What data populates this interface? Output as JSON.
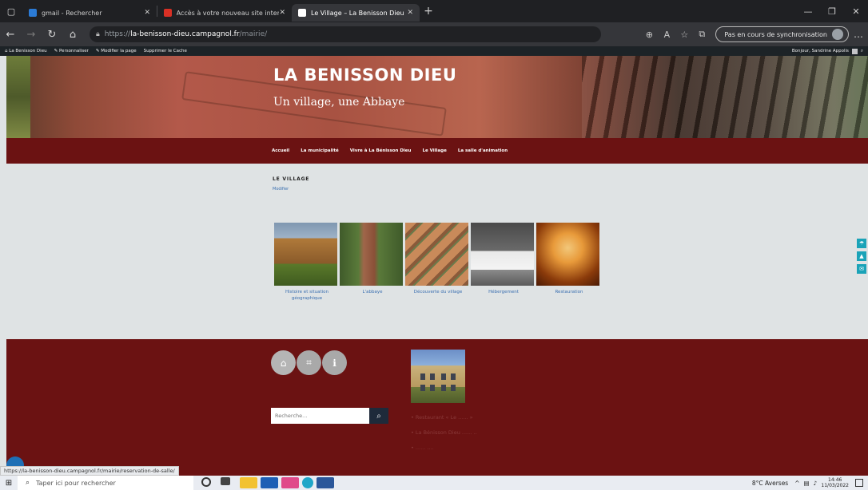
{
  "browser": {
    "tabs": [
      {
        "label": "gmail - Rechercher",
        "favicon_color": "#2b7bd6"
      },
      {
        "label": "Accès à votre nouveau site intern",
        "favicon_color": "#d93025"
      },
      {
        "label": "Le Village – La Benisson Dieu",
        "favicon_color": "#ffffff",
        "active": true
      }
    ],
    "url_scheme": "https://",
    "url_host": "la-benisson-dieu.campagnol.fr",
    "url_path": "/mairie/",
    "sync_label": "Pas en cours de synchronisation"
  },
  "wp_admin_bar": {
    "site_name": "La Benisson Dieu",
    "customize": "Personnaliser",
    "edit_page": "Modifier la page",
    "clear_cache": "Supprimer le Cache",
    "greeting": "Bonjour, Sandrine Appolis"
  },
  "header": {
    "title": "LA BENISSON DIEU",
    "tagline": "Un village, une Abbaye"
  },
  "nav": {
    "items": [
      "Accueil",
      "La municipalité",
      "Vivre à La Bénisson Dieu",
      "Le Village",
      "La salle d'animation"
    ]
  },
  "content": {
    "heading": "LE VILLAGE",
    "edit_label": "Modifier",
    "gallery": [
      {
        "caption": "Histoire et situation géographique",
        "palette": [
          "#6a7a8c",
          "#b07a3a",
          "#5a7a2a"
        ]
      },
      {
        "caption": "L'abbaye",
        "palette": [
          "#3f5a2a",
          "#a0664a",
          "#6b8a4a"
        ]
      },
      {
        "caption": "Découverte du village",
        "palette": [
          "#8a5a3a",
          "#c98a5a",
          "#6b7a4a"
        ]
      },
      {
        "caption": "Hébergement",
        "palette": [
          "#5a5a5a",
          "#e8e8e8",
          "#8a8a8a"
        ]
      },
      {
        "caption": "Restauration",
        "palette": [
          "#8a3a0a",
          "#e89a3a",
          "#f2c77a"
        ]
      }
    ]
  },
  "footer": {
    "search_placeholder": "Recherche...",
    "links": [
      "• Restaurant « Le ...... »",
      "• La Bénisson Dieu ...... ..",
      "• ...... ...."
    ]
  },
  "status_url": "https://la-benisson-dieu.campagnol.fr/mairie/reservation-de-salle/",
  "taskbar": {
    "search_placeholder": "Taper ici pour rechercher",
    "weather": "8°C Averses",
    "time": "14:46",
    "date": "11/03/2022"
  },
  "colors": {
    "brand_red": "#6b1212",
    "content_bg": "#dfe3e4",
    "link_blue": "#3a6fb0",
    "widget_teal": "#1aa3b8"
  }
}
